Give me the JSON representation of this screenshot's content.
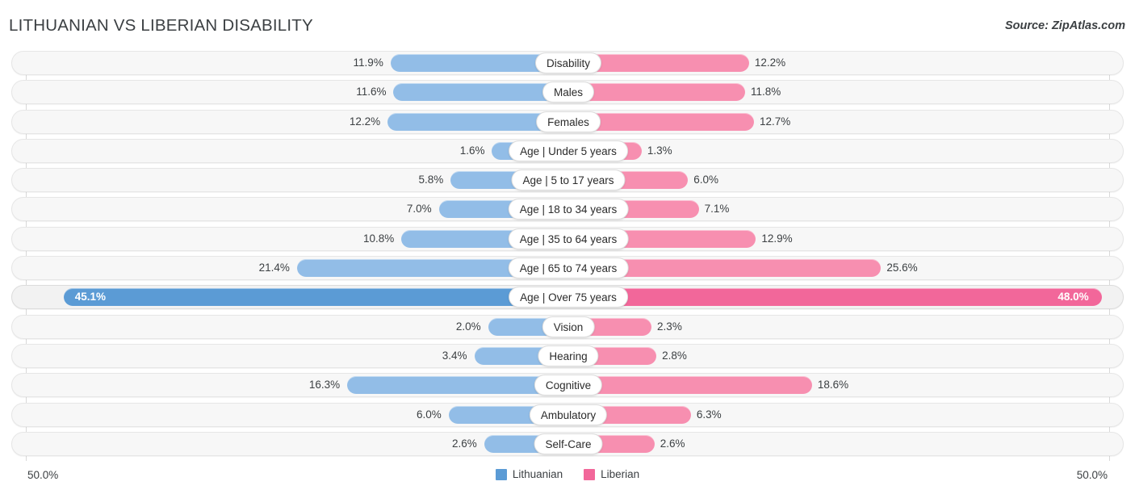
{
  "header": {
    "title": "LITHUANIAN VS LIBERIAN DISABILITY",
    "source": "Source: ZipAtlas.com"
  },
  "footer": {
    "axis_left": "50.0%",
    "axis_right": "50.0%",
    "legend": [
      {
        "label": "Lithuanian",
        "color": "#5b9bd5"
      },
      {
        "label": "Liberian",
        "color": "#f2679a"
      }
    ]
  },
  "chart_data": {
    "type": "bar",
    "subtype": "diverging-bidirectional",
    "title": "LITHUANIAN VS LIBERIAN DISABILITY",
    "xlabel": "",
    "ylabel": "",
    "xlim": [
      -50.0,
      50.0
    ],
    "axis_tick_labels": [
      "50.0%",
      "50.0%"
    ],
    "grid": true,
    "legend_position": "bottom-center",
    "series": [
      {
        "name": "Lithuanian",
        "color": "#5b9bd5",
        "light_color": "#92bde7",
        "values": [
          11.9,
          11.6,
          12.2,
          1.6,
          5.8,
          7.0,
          10.8,
          21.4,
          45.1,
          2.0,
          3.4,
          16.3,
          6.0,
          2.4
        ]
      },
      {
        "name": "Liberian",
        "color": "#f2679a",
        "light_color": "#f78fb0",
        "values": [
          12.2,
          11.8,
          12.7,
          1.3,
          6.0,
          7.1,
          12.9,
          25.6,
          48.0,
          2.3,
          2.8,
          18.6,
          6.3,
          2.6
        ]
      }
    ],
    "categories": [
      "Disability",
      "Males",
      "Females",
      "Age | Under 5 years",
      "Age | 5 to 17 years",
      "Age | 18 to 34 years",
      "Age | 35 to 64 years",
      "Age | 65 to 74 years",
      "Age | Over 75 years",
      "Vision",
      "Hearing",
      "Cognitive",
      "Ambulatory",
      "Self-Care"
    ],
    "rows": [
      {
        "label": "Disability",
        "left_value": 11.9,
        "right_value": 12.2,
        "left_text": "11.9%",
        "right_text": "12.2%",
        "highlight": false
      },
      {
        "label": "Males",
        "left_value": 11.6,
        "right_value": 11.8,
        "left_text": "11.6%",
        "right_text": "11.8%",
        "highlight": false
      },
      {
        "label": "Females",
        "left_value": 12.2,
        "right_value": 12.7,
        "left_text": "12.2%",
        "right_text": "12.7%",
        "highlight": false
      },
      {
        "label": "Age | Under 5 years",
        "left_value": 1.6,
        "right_value": 1.3,
        "left_text": "1.6%",
        "right_text": "1.3%",
        "highlight": false
      },
      {
        "label": "Age | 5 to 17 years",
        "left_value": 5.8,
        "right_value": 6.0,
        "left_text": "5.8%",
        "right_text": "6.0%",
        "highlight": false
      },
      {
        "label": "Age | 18 to 34 years",
        "left_value": 7.0,
        "right_value": 7.1,
        "left_text": "7.0%",
        "right_text": "7.1%",
        "highlight": false
      },
      {
        "label": "Age | 35 to 64 years",
        "left_value": 10.8,
        "right_value": 12.9,
        "left_text": "10.8%",
        "right_text": "12.9%",
        "highlight": false
      },
      {
        "label": "Age | 65 to 74 years",
        "left_value": 21.4,
        "right_value": 25.6,
        "left_text": "21.4%",
        "right_text": "25.6%",
        "highlight": false
      },
      {
        "label": "Age | Over 75 years",
        "left_value": 45.1,
        "right_value": 48.0,
        "left_text": "45.1%",
        "right_text": "48.0%",
        "highlight": true
      },
      {
        "label": "Vision",
        "left_value": 2.0,
        "right_value": 2.3,
        "left_text": "2.0%",
        "right_text": "2.3%",
        "highlight": false
      },
      {
        "label": "Hearing",
        "left_value": 3.4,
        "right_value": 2.8,
        "left_text": "3.4%",
        "right_text": "2.8%",
        "highlight": false
      },
      {
        "label": "Cognitive",
        "left_value": 16.3,
        "right_value": 18.6,
        "left_text": "16.3%",
        "right_text": "18.6%",
        "highlight": false
      },
      {
        "label": "Ambulatory",
        "left_value": 6.0,
        "right_value": 6.3,
        "left_text": "6.0%",
        "right_text": "6.3%",
        "highlight": false
      },
      {
        "label": "Self-Care",
        "left_value": 2.4,
        "right_value": 2.6,
        "left_text": "2.6%",
        "right_text": "2.6%",
        "highlight": false
      }
    ]
  }
}
